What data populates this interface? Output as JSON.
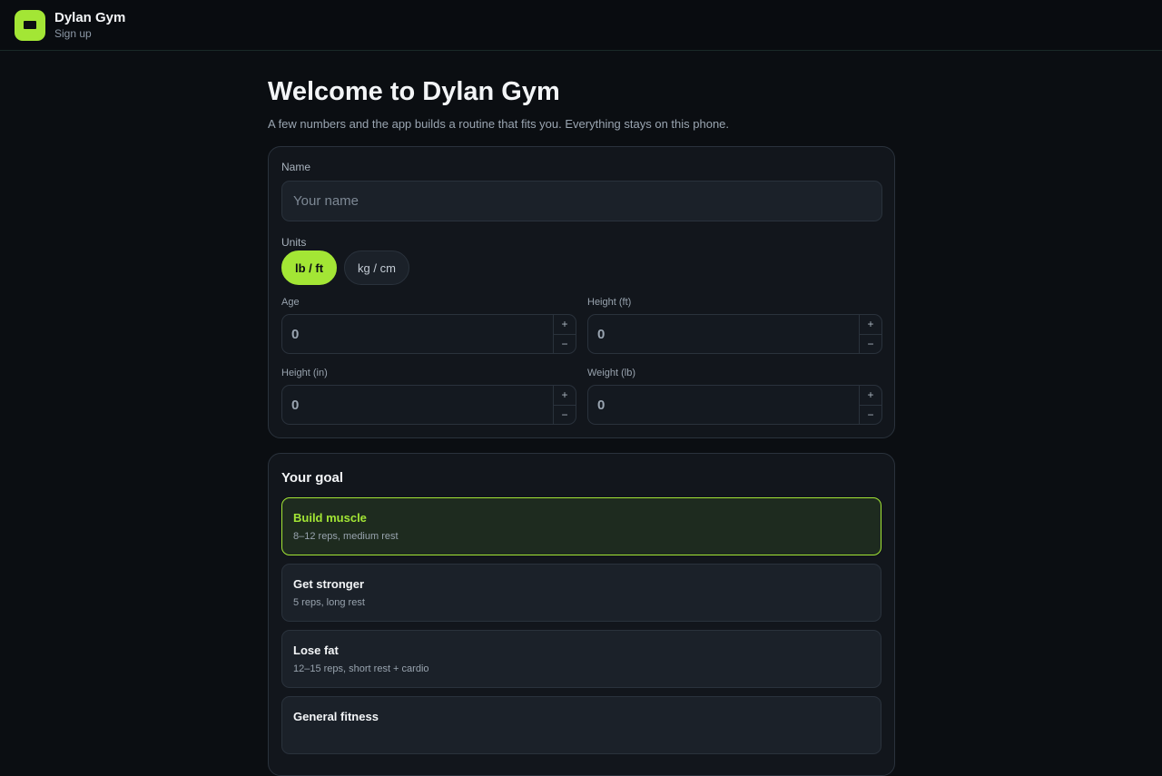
{
  "app": {
    "title": "Dylan Gym",
    "subtitle": "Sign up"
  },
  "icons": {
    "logo": "dumbbell-icon"
  },
  "colors": {
    "accent": "#a3e635",
    "background": "#0b0e12",
    "card": "#12161c"
  },
  "page": {
    "title": "Welcome to Dylan Gym",
    "subtitle": "A few numbers and the app builds a routine that fits you. Everything stays on this phone."
  },
  "profile": {
    "name_label": "Name",
    "name_placeholder": "Your name",
    "name_value": "",
    "units_label": "Units",
    "units_options": [
      "lb / ft",
      "kg / cm"
    ],
    "units_selected": "lb / ft",
    "fields": [
      {
        "label": "Age",
        "value": "0"
      },
      {
        "label": "Height (ft)",
        "value": "0"
      },
      {
        "label": "Height (in)",
        "value": "0"
      },
      {
        "label": "Weight (lb)",
        "value": "0"
      }
    ],
    "increment": "+",
    "decrement": "−"
  },
  "goal": {
    "title": "Your goal",
    "selected": "Build muscle",
    "options": [
      {
        "name": "Build muscle",
        "desc": "8–12 reps, medium rest"
      },
      {
        "name": "Get stronger",
        "desc": "5 reps, long rest"
      },
      {
        "name": "Lose fat",
        "desc": "12–15 reps, short rest + cardio"
      },
      {
        "name": "General fitness",
        "desc": ""
      }
    ]
  }
}
